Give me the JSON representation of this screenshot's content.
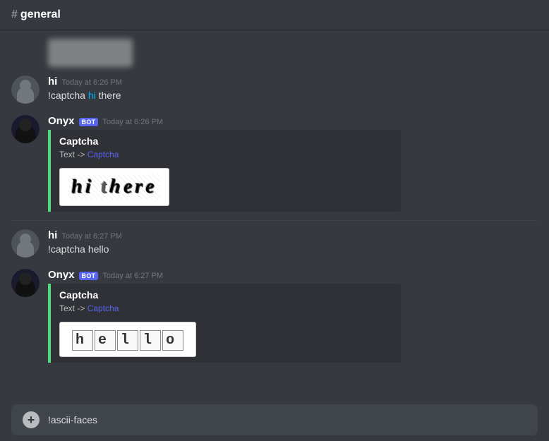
{
  "channel": {
    "name": "general",
    "hash": "#"
  },
  "top_attachment": {
    "blurred": true
  },
  "messages": [
    {
      "id": "msg1",
      "type": "user",
      "username": "hi",
      "timestamp": "Today at 6:26 PM",
      "text_prefix": "!captcha ",
      "text_highlight": "hi",
      "text_rest": " there",
      "is_bot": false
    },
    {
      "id": "msg2",
      "type": "bot",
      "username": "Onyx",
      "bot_badge": "BOT",
      "timestamp": "Today at 6:26 PM",
      "is_bot": true,
      "embed": {
        "title": "Captcha",
        "field": "Text -> Captcha",
        "field_highlight": "Captcha",
        "captcha_text": "hi there",
        "captcha_version": 1
      }
    },
    {
      "id": "msg3",
      "type": "user",
      "username": "hi",
      "timestamp": "Today at 6:27 PM",
      "text_prefix": "!captcha ",
      "text_rest": "hello",
      "is_bot": false
    },
    {
      "id": "msg4",
      "type": "bot",
      "username": "Onyx",
      "bot_badge": "BOT",
      "timestamp": "Today at 6:27 PM",
      "is_bot": true,
      "embed": {
        "title": "Captcha",
        "field": "Text -> Captcha",
        "field_highlight": "Captcha",
        "captcha_text": "hello",
        "captcha_version": 2
      }
    }
  ],
  "input": {
    "placeholder": "!ascii-faces",
    "value": "!ascii-faces"
  },
  "labels": {
    "bot": "BOT"
  }
}
